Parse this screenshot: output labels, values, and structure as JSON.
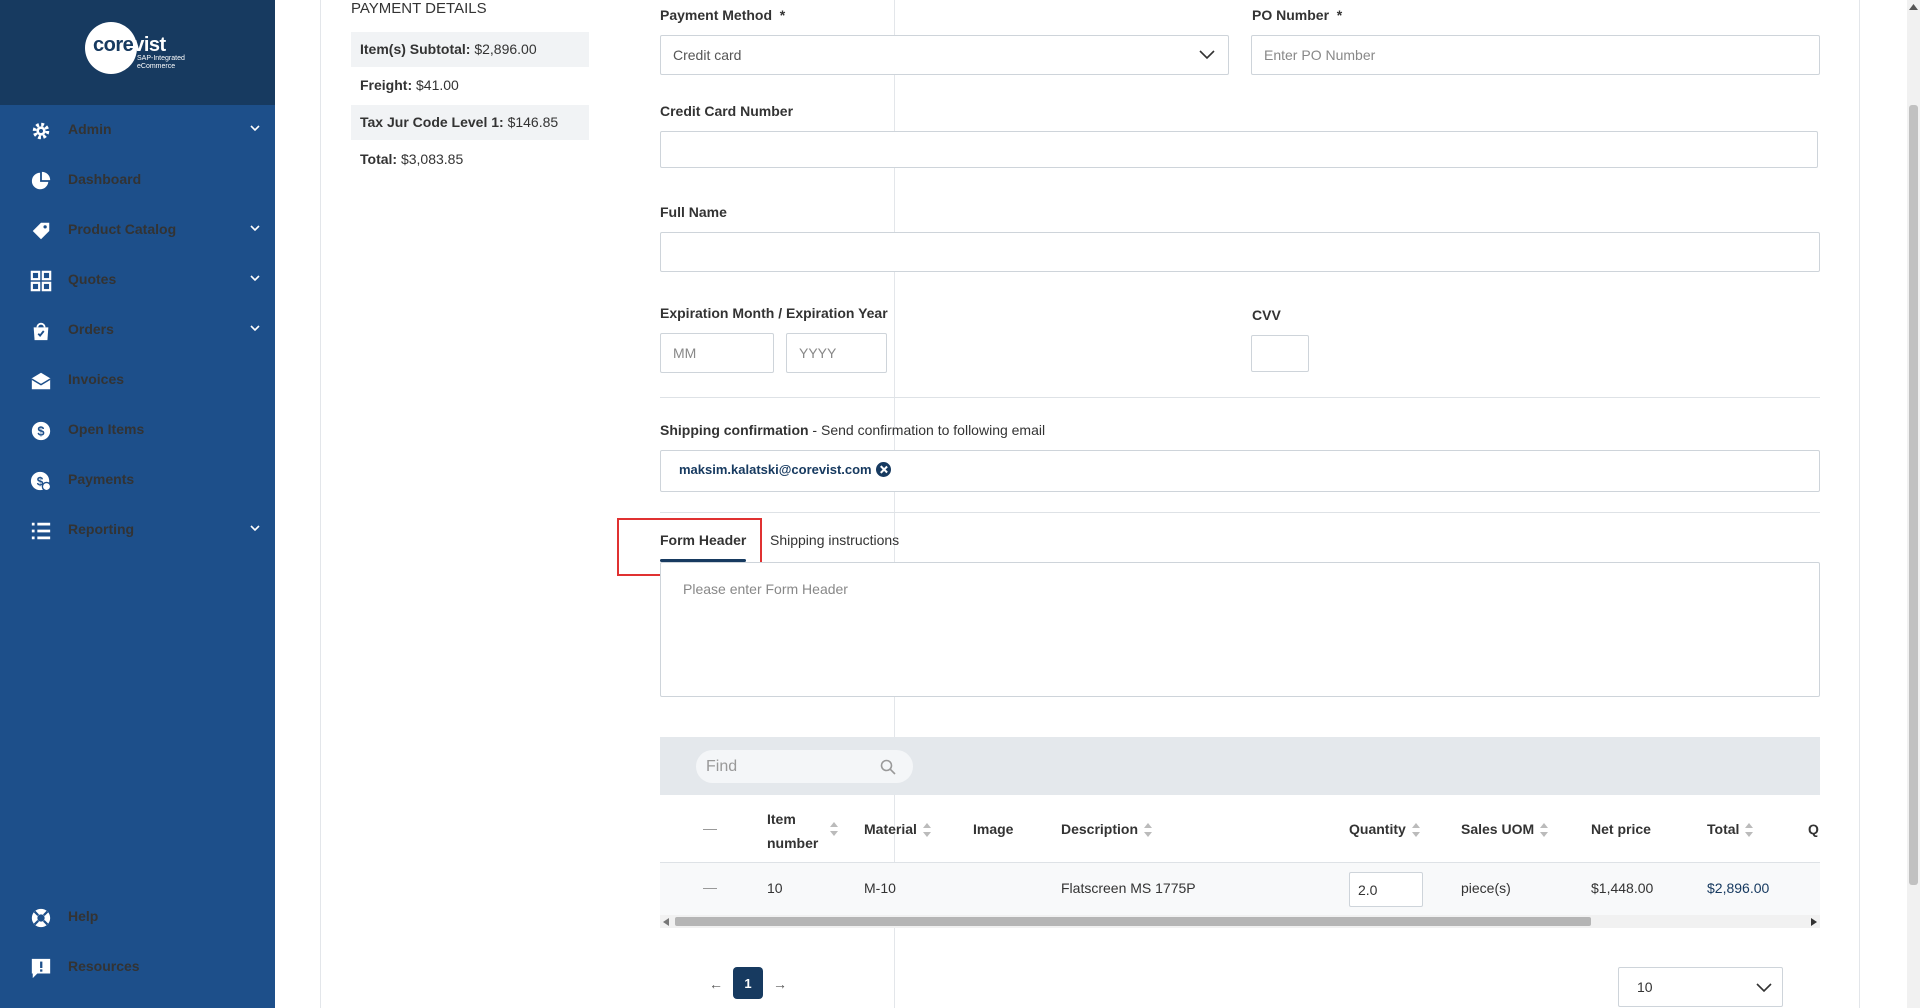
{
  "brand": {
    "logo_main": "corevist",
    "logo_sub_1": "SAP-Integrated",
    "logo_sub_2": "eCommerce"
  },
  "sidebar": {
    "items": [
      {
        "label": "Admin",
        "icon": "gear-icon",
        "expandable": true
      },
      {
        "label": "Dashboard",
        "icon": "pie-chart-icon",
        "expandable": false
      },
      {
        "label": "Product Catalog",
        "icon": "tag-icon",
        "expandable": true
      },
      {
        "label": "Quotes",
        "icon": "grid-icon",
        "expandable": true
      },
      {
        "label": "Orders",
        "icon": "shopping-bag-icon",
        "expandable": true
      },
      {
        "label": "Invoices",
        "icon": "envelope-icon",
        "expandable": false
      },
      {
        "label": "Open Items",
        "icon": "dollar-circle-icon",
        "expandable": false
      },
      {
        "label": "Payments",
        "icon": "payment-icon",
        "expandable": false
      },
      {
        "label": "Reporting",
        "icon": "list-icon",
        "expandable": true
      }
    ],
    "bottom_items": [
      {
        "label": "Help",
        "icon": "lifebuoy-icon"
      },
      {
        "label": "Resources",
        "icon": "info-board-icon"
      }
    ]
  },
  "payment_details": {
    "title": "PAYMENT DETAILS",
    "rows": [
      {
        "label": "Item(s) Subtotal:",
        "value": "$2,896.00"
      },
      {
        "label": "Freight:",
        "value": "$41.00"
      },
      {
        "label": "Tax Jur Code Level 1:",
        "value": "$146.85"
      },
      {
        "label": "Total:",
        "value": "$3,083.85"
      }
    ]
  },
  "form": {
    "payment_method_label": "Payment Method",
    "payment_method_value": "Credit card",
    "po_number_label": "PO Number",
    "po_number_placeholder": "Enter PO Number",
    "required_mark": "*",
    "cc_number_label": "Credit Card Number",
    "full_name_label": "Full Name",
    "expiration_label": "Expiration Month / Expiration Year",
    "month_placeholder": "MM",
    "year_placeholder": "YYYY",
    "cvv_label": "CVV",
    "shipping_conf_label": "Shipping confirmation",
    "shipping_conf_desc": " - Send confirmation to following email",
    "email_chip": "maksim.kalatski@corevist.com"
  },
  "tabs": [
    {
      "label": "Form Header",
      "active": true
    },
    {
      "label": "Shipping instructions",
      "active": false
    }
  ],
  "textarea_placeholder": "Please enter Form Header",
  "table": {
    "find_placeholder": "Find",
    "columns": [
      {
        "label": "Item",
        "label2": "number"
      },
      {
        "label": "Material"
      },
      {
        "label": "Image"
      },
      {
        "label": "Description"
      },
      {
        "label": "Quantity"
      },
      {
        "label": "Sales UOM"
      },
      {
        "label": "Net price"
      },
      {
        "label": "Total"
      },
      {
        "label": "Q"
      }
    ],
    "rows": [
      {
        "item_number": "10",
        "material": "M-10",
        "description": "Flatscreen MS 1775P",
        "quantity": "2.0",
        "sales_uom": "piece(s)",
        "net_price": "$1,448.00",
        "total": "$2,896.00"
      }
    ]
  },
  "pagination": {
    "prev": "←",
    "next": "→",
    "current_page": "1",
    "page_size": "10"
  },
  "colors": {
    "sidebar": "#1d4f8a",
    "sidebar_brand": "#173a60",
    "accent": "#173a60",
    "highlight": "#e03131"
  }
}
